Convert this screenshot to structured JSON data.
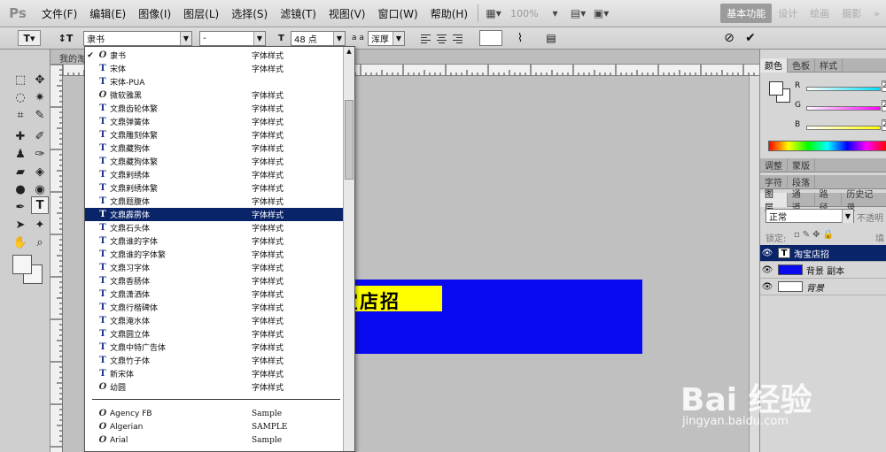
{
  "app": {
    "logo": "Ps"
  },
  "menubar": {
    "items": [
      "文件(F)",
      "编辑(E)",
      "图像(I)",
      "图层(L)",
      "选择(S)",
      "滤镜(T)",
      "视图(V)",
      "窗口(W)",
      "帮助(H)"
    ],
    "zoom": "100%",
    "workspaces": [
      "基本功能",
      "设计",
      "绘画",
      "摄影"
    ],
    "more": "»"
  },
  "options": {
    "font_family": "隶书",
    "font_style": "-",
    "font_size": "48 点",
    "antialias_label": "a a",
    "antialias": "浑厚",
    "cancel_icon": "⊘",
    "commit_icon": "✔"
  },
  "document": {
    "tab_label": "我的淘"
  },
  "canvas": {
    "text": "宝店招",
    "rect_color": "#0a0af0",
    "label_color": "#ffff00"
  },
  "font_list": [
    {
      "check": "✔",
      "type": "O",
      "name": "隶书",
      "sample": "字体样式"
    },
    {
      "check": "",
      "type": "T",
      "name": "宋体",
      "sample": "字体样式"
    },
    {
      "check": "",
      "type": "T",
      "name": "宋体-PUA",
      "sample": ""
    },
    {
      "check": "",
      "type": "O",
      "name": "微软雅黑",
      "sample": "字体样式"
    },
    {
      "check": "",
      "type": "T",
      "name": "文鼎齿轮体繁",
      "sample": "字体样式"
    },
    {
      "check": "",
      "type": "T",
      "name": "文鼎弹簧体",
      "sample": "字体样式"
    },
    {
      "check": "",
      "type": "T",
      "name": "文鼎雕刻体繁",
      "sample": "字体样式"
    },
    {
      "check": "",
      "type": "T",
      "name": "文鼎藏狗体",
      "sample": "字体样式"
    },
    {
      "check": "",
      "type": "T",
      "name": "文鼎藏狗体繁",
      "sample": "字体样式"
    },
    {
      "check": "",
      "type": "T",
      "name": "文鼎剌绣体",
      "sample": "字体样式"
    },
    {
      "check": "",
      "type": "T",
      "name": "文鼎剌绣体繁",
      "sample": "字体样式"
    },
    {
      "check": "",
      "type": "T",
      "name": "文鼎题腹体",
      "sample": "字体样式"
    },
    {
      "check": "",
      "type": "T",
      "name": "文鼎霹雳体",
      "sample": "字体样式"
    },
    {
      "check": "",
      "type": "T",
      "name": "文鼎石头体",
      "sample": "字体样式"
    },
    {
      "check": "",
      "type": "T",
      "name": "文鼎谁的字体",
      "sample": "字体样式"
    },
    {
      "check": "",
      "type": "T",
      "name": "文鼎谁的字体繁",
      "sample": "字体样式"
    },
    {
      "check": "",
      "type": "T",
      "name": "文鼎习字体",
      "sample": "字体样式"
    },
    {
      "check": "",
      "type": "T",
      "name": "文鼎香肠体",
      "sample": "字体样式"
    },
    {
      "check": "",
      "type": "T",
      "name": "文鼎潇洒体",
      "sample": "字体样式"
    },
    {
      "check": "",
      "type": "T",
      "name": "文鼎行楷碑体",
      "sample": "字体样式"
    },
    {
      "check": "",
      "type": "T",
      "name": "文鼎淹水体",
      "sample": "字体样式"
    },
    {
      "check": "",
      "type": "T",
      "name": "文鼎圆立体",
      "sample": "字体样式"
    },
    {
      "check": "",
      "type": "T",
      "name": "文鼎中特广告体",
      "sample": "字体样式"
    },
    {
      "check": "",
      "type": "T",
      "name": "文鼎竹子体",
      "sample": "字体样式"
    },
    {
      "check": "",
      "type": "T",
      "name": "新宋体",
      "sample": "字体样式"
    },
    {
      "check": "",
      "type": "O",
      "name": "幼圆",
      "sample": "字体样式"
    },
    {
      "check": "",
      "type": "O",
      "name": "Agency FB",
      "sample": "Sample"
    },
    {
      "check": "",
      "type": "O",
      "name": "Algerian",
      "sample": "SAMPLE"
    },
    {
      "check": "",
      "type": "O",
      "name": "Arial",
      "sample": "Sample"
    }
  ],
  "right_panels": {
    "color_tabs": [
      "颜色",
      "色板",
      "样式"
    ],
    "sliders": [
      {
        "label": "R",
        "color": "#00e0ff",
        "value": "2"
      },
      {
        "label": "G",
        "color": "#ff00ff",
        "value": "2"
      },
      {
        "label": "B",
        "color": "#ffff00",
        "value": "2"
      }
    ],
    "adjust_tabs": [
      "调整",
      "蒙版"
    ],
    "char_tabs": [
      "字符",
      "段落"
    ],
    "layers_tabs": [
      "图层",
      "通道",
      "路径",
      "历史记录"
    ],
    "blend_mode": "正常",
    "opacity_label": "不透明",
    "lock_label": "锁定:",
    "fill_label": "填",
    "layers": [
      {
        "name": "淘宝店招",
        "thumb": "T",
        "selected": true
      },
      {
        "name": "背景 副本",
        "thumb": "blue",
        "selected": false
      },
      {
        "name": "背景",
        "thumb": "white",
        "selected": false
      }
    ]
  },
  "watermark": {
    "brand": "Bai 经验",
    "url": "jingyan.baidu.com"
  }
}
